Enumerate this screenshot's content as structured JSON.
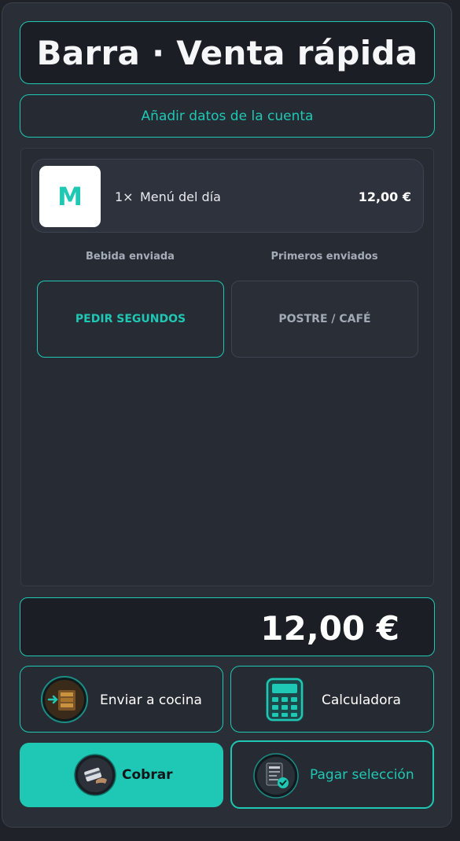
{
  "header": {
    "title": "Barra · Venta rápida"
  },
  "account": {
    "label": "Añadir datos de la cuenta"
  },
  "order": {
    "lines": [
      {
        "avatar_letter": "M",
        "quantity": "1×",
        "name": "Menú del día",
        "price": "12,00 €"
      }
    ],
    "status": {
      "left": "Bebida enviada",
      "right": "Primeros enviados"
    },
    "courses": {
      "next": "PEDIR SEGUNDOS",
      "later": "POSTRE / CAFÉ"
    }
  },
  "total": {
    "amount": "12,00 €"
  },
  "actions": {
    "send_kitchen": "Enviar a cocina",
    "calculator": "Calculadora",
    "charge": "Cobrar",
    "pay_selection": "Pagar selección"
  },
  "colors": {
    "accent": "#1fc8b4",
    "panel": "#2a2e37",
    "dark": "#1b1e25"
  }
}
